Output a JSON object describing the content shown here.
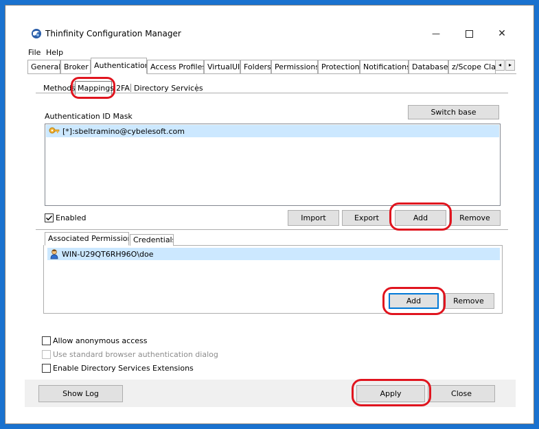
{
  "window": {
    "title": "Thinfinity Configuration Manager",
    "minimize_glyph": "—",
    "maximize_glyph": "☐",
    "close_glyph": "✕"
  },
  "menu": {
    "items": [
      "File",
      "Help"
    ]
  },
  "main_tabs": [
    "General",
    "Broker",
    "Authentication",
    "Access Profiles",
    "VirtualUI",
    "Folders",
    "Permissions",
    "Protection",
    "Notifications",
    "Database",
    "z/Scope Clas"
  ],
  "tab_scroll": {
    "left": "◂",
    "right": "▸"
  },
  "sub_tabs": [
    "Methods",
    "Mappings",
    "2FA",
    "Directory Services"
  ],
  "mappings": {
    "mask_label": "Authentication ID Mask",
    "switch_base": "Switch base",
    "entries": [
      "[*]:sbeltramino@cybelesoft.com"
    ],
    "enabled_label": "Enabled",
    "enabled_checked": true,
    "import": "Import",
    "export": "Export",
    "add": "Add",
    "remove": "Remove"
  },
  "permissions": {
    "tabs": [
      "Associated Permissions",
      "Credentials"
    ],
    "entries": [
      "WIN-U29QT6RH96O\\doe"
    ],
    "add": "Add",
    "remove": "Remove"
  },
  "options": {
    "allow_anonymous": "Allow anonymous access",
    "standard_dialog": "Use standard browser authentication dialog",
    "directory_extensions": "Enable Directory Services Extensions"
  },
  "footer": {
    "show_log": "Show Log",
    "apply": "Apply",
    "close": "Close"
  },
  "colors": {
    "desktop": "#1a72cf",
    "highlight": "#cce8ff",
    "annotation": "#e0141e",
    "default_button_border": "#0078d7"
  }
}
